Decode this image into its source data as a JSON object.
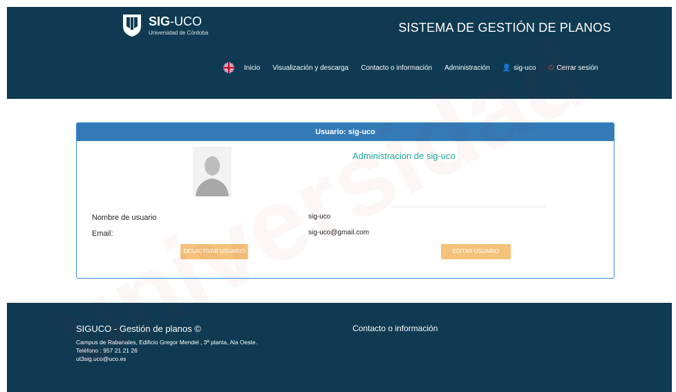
{
  "header": {
    "brand_bold": "SIG",
    "brand_rest": "-UCO",
    "brand_sub": "Universidad de Córdoba",
    "system_title": "SISTEMA DE GESTIÓN DE PLANOS",
    "nav": {
      "language_icon": "uk-flag-icon",
      "items": [
        "Inicio",
        "Visualización y descarga",
        "Contacto o información",
        "Administración"
      ],
      "user": "sig-uco",
      "user_icon": "user-icon",
      "logout": "Cerrar sesión",
      "logout_icon": "power-icon"
    }
  },
  "card": {
    "header": "Usuario: sig-uco",
    "admin_title": "Administracion de sig-uco",
    "fields": [
      {
        "label": "Nombre de usuario",
        "value": "sig-uco"
      },
      {
        "label": "Email:",
        "value": "sig-uco@gmail.com"
      }
    ],
    "buttons": {
      "deactivate": "DESACTIVAR USUARIO",
      "edit": "EDITAR USUARIO"
    }
  },
  "footer": {
    "title": "SIGUCO - Gestión de planos ©",
    "address": "Campus de Rabanales, Edificio Gregor Mendel , 3ª planta, Ala Oeste.",
    "phone": "Teléfono : 957 21 21 26",
    "email": "ut3sig.uco@uco.es",
    "contact_heading": "Contacto o información"
  },
  "colors": {
    "navy": "#0f3a52",
    "card_header": "#337ab7",
    "accent": "#1aaa9a",
    "button": "#f4c27a"
  }
}
